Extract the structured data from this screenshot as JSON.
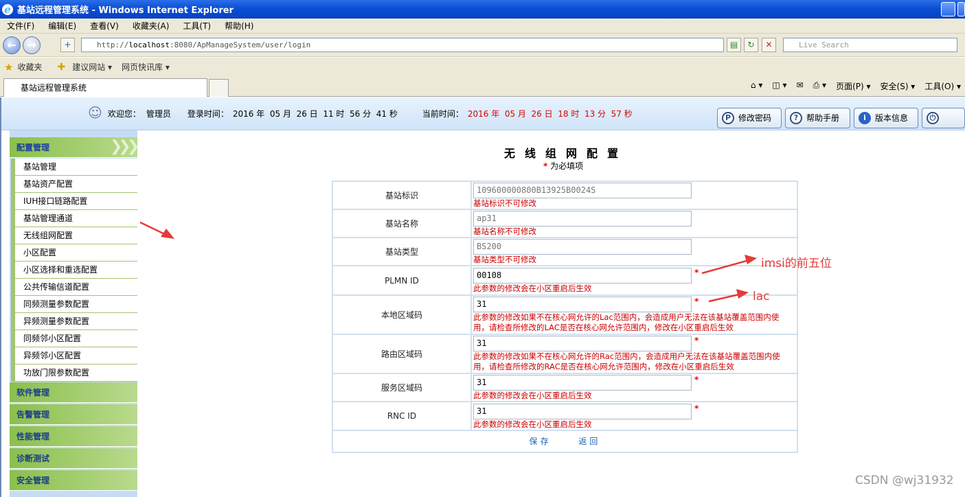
{
  "window": {
    "title": "基站远程管理系统 - Windows Internet Explorer"
  },
  "menu": [
    "文件(F)",
    "编辑(E)",
    "查看(V)",
    "收藏夹(A)",
    "工具(T)",
    "帮助(H)"
  ],
  "address": {
    "prefix": "http://",
    "host": "localhost",
    "rest": ":8080/ApManageSystem/user/login"
  },
  "search": {
    "placeholder": "Live Search"
  },
  "favorites": {
    "label": "收藏夹",
    "items": [
      "建议网站 ▾",
      "网页快讯库 ▾"
    ]
  },
  "tab": {
    "label": "基站远程管理系统"
  },
  "commands": [
    "页面(P) ▾",
    "安全(S) ▾",
    "工具(O) ▾"
  ],
  "header": {
    "welcome_label": "欢迎您：",
    "user": "管理员",
    "login_label": "登录时间：",
    "login_time": "2016 年  05 月  26 日  11 时  56 分  41 秒",
    "now_label": "当前时间：",
    "now_time": "2016 年  05 月  26 日  18 时  13 分  57 秒",
    "buttons": [
      "修改密码",
      "帮助手册",
      "版本信息",
      "注  销"
    ]
  },
  "sidebar": {
    "sections": [
      "配置管理",
      "软件管理",
      "告警管理",
      "性能管理",
      "诊断测试",
      "安全管理"
    ],
    "items": [
      "基站管理",
      "基站资产配置",
      "IUH接口链路配置",
      "基站管理通道",
      "无线组网配置",
      "小区配置",
      "小区选择和重选配置",
      "公共传输信道配置",
      "同频测量参数配置",
      "异频测量参数配置",
      "同频邻小区配置",
      "异频邻小区配置",
      "功放门限参数配置"
    ]
  },
  "form": {
    "title": "无线组网配置",
    "required_note": "为必填项",
    "required_star": "*",
    "rows": [
      {
        "label": "基站标识",
        "value": "109600000800B13925B0024S",
        "note": "基站标识不可修改",
        "note2": ""
      },
      {
        "label": "基站名称",
        "value": "ap31",
        "note": "基站名称不可修改",
        "note2": ""
      },
      {
        "label": "基站类型",
        "value": "BS200",
        "note": "基站类型不可修改",
        "note2": ""
      },
      {
        "label": "PLMN ID",
        "value": "00108",
        "note": "此参数的修改会在小区重启后生效",
        "note2": ""
      },
      {
        "label": "本地区域码",
        "value": "31",
        "note": "此参数的修改如果不在核心网允许的Lac范围内，会造成用户无法在该基站覆盖范围内使",
        "note2": "用，请检查所修改的LAC是否在核心网允许范围内，修改在小区重启后生效"
      },
      {
        "label": "路由区域码",
        "value": "31",
        "note": "此参数的修改如果不在核心网允许的Rac范围内，会造成用户无法在该基站覆盖范围内使",
        "note2": "用，请检查所修改的RAC是否在核心网允许范围内，修改在小区重启后生效"
      },
      {
        "label": "服务区域码",
        "value": "31",
        "note": "此参数的修改会在小区重启后生效",
        "note2": ""
      },
      {
        "label": "RNC ID",
        "value": "31",
        "note": "此参数的修改会在小区重启后生效",
        "note2": ""
      }
    ],
    "save": "保存",
    "back": "返回"
  },
  "annotations": {
    "imsi": "imsi的前五位",
    "lac": "lac"
  },
  "watermark": "CSDN @wj31932",
  "colors": {
    "annotation": "#e53a3a",
    "required": "#e00000",
    "note": "#cc0000"
  }
}
